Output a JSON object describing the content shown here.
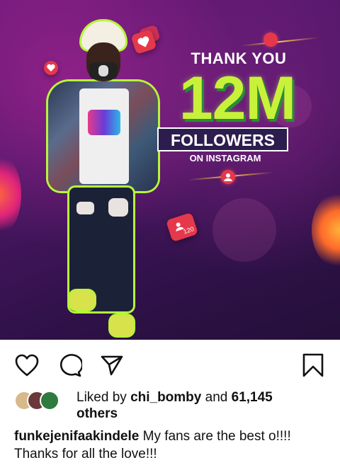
{
  "post": {
    "headline": {
      "thank_you": "THANK YOU",
      "count": "12M",
      "followers": "FOLLOWERS",
      "subtitle": "ON INSTAGRAM"
    },
    "notification_count": "120"
  },
  "actions": {
    "like_icon": "heart-outline-icon",
    "comment_icon": "comment-bubble-icon",
    "share_icon": "paper-plane-icon",
    "save_icon": "bookmark-icon"
  },
  "likes": {
    "prefix": "Liked by",
    "user": "chi_bomby",
    "connector": "and",
    "count": "61,145",
    "suffix": "others"
  },
  "caption": {
    "username": "funkejenifaakindele",
    "text": "My fans are the best o!!!! Thanks for all the love!!!"
  },
  "colors": {
    "brand_green": "#c8f23a",
    "ig_red": "#e5384b",
    "bg_purple": "#4a1764"
  }
}
